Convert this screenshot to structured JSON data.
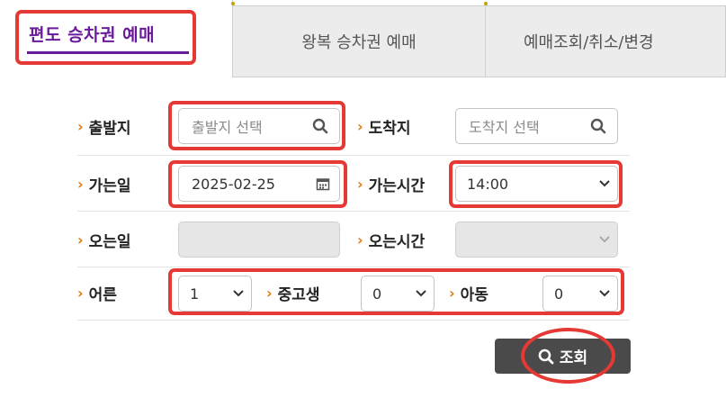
{
  "tabs": {
    "active": "편도 승차권 예매",
    "round_trip": "왕복 승차권 예매",
    "manage": "예매조회/취소/변경"
  },
  "form": {
    "departure_label": "출발지",
    "departure_placeholder": "출발지 선택",
    "arrival_label": "도착지",
    "arrival_placeholder": "도착지 선택",
    "go_date_label": "가는일",
    "go_date_value": "2025-02-25",
    "go_time_label": "가는시간",
    "go_time_value": "14:00",
    "return_date_label": "오는일",
    "return_time_label": "오는시간",
    "adult_label": "어른",
    "adult_value": "1",
    "student_label": "중고생",
    "student_value": "0",
    "child_label": "아동",
    "child_value": "0",
    "search_button": "조회"
  },
  "icons": {
    "search": "search-icon",
    "calendar": "calendar-icon",
    "chevron": "chevron-down-icon"
  },
  "colors": {
    "active_tab": "#6a1b9a",
    "highlight": "#e53935",
    "label_arrow": "#e07a10",
    "button": "#4a4a4a"
  }
}
